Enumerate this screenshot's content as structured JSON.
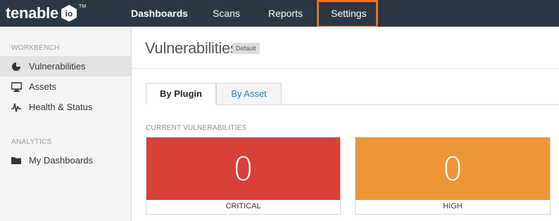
{
  "app": {
    "logo_text": "tenable",
    "logo_suffix": "io",
    "logo_tm": "TM"
  },
  "topnav": {
    "items": [
      {
        "label": "Dashboards"
      },
      {
        "label": "Scans"
      },
      {
        "label": "Reports"
      },
      {
        "label": "Settings"
      }
    ],
    "highlight_color": "#e8722c"
  },
  "sidebar": {
    "workbench_label": "WORKBENCH",
    "analytics_label": "ANALYTICS",
    "items": [
      {
        "label": "Vulnerabilities",
        "icon": "pie-chart-icon"
      },
      {
        "label": "Assets",
        "icon": "monitor-icon"
      },
      {
        "label": "Health & Status",
        "icon": "pulse-icon"
      },
      {
        "label": "My Dashboards",
        "icon": "folder-icon"
      }
    ]
  },
  "main": {
    "title": "Vulnerabilities",
    "badge": "Default",
    "tabs": [
      {
        "label": "By Plugin"
      },
      {
        "label": "By Asset"
      }
    ],
    "section_label": "CURRENT VULNERABILITIES",
    "cards": [
      {
        "count": "0",
        "label": "CRITICAL",
        "color": "#d8403a"
      },
      {
        "count": "0",
        "label": "HIGH",
        "color": "#ee9537"
      }
    ]
  }
}
